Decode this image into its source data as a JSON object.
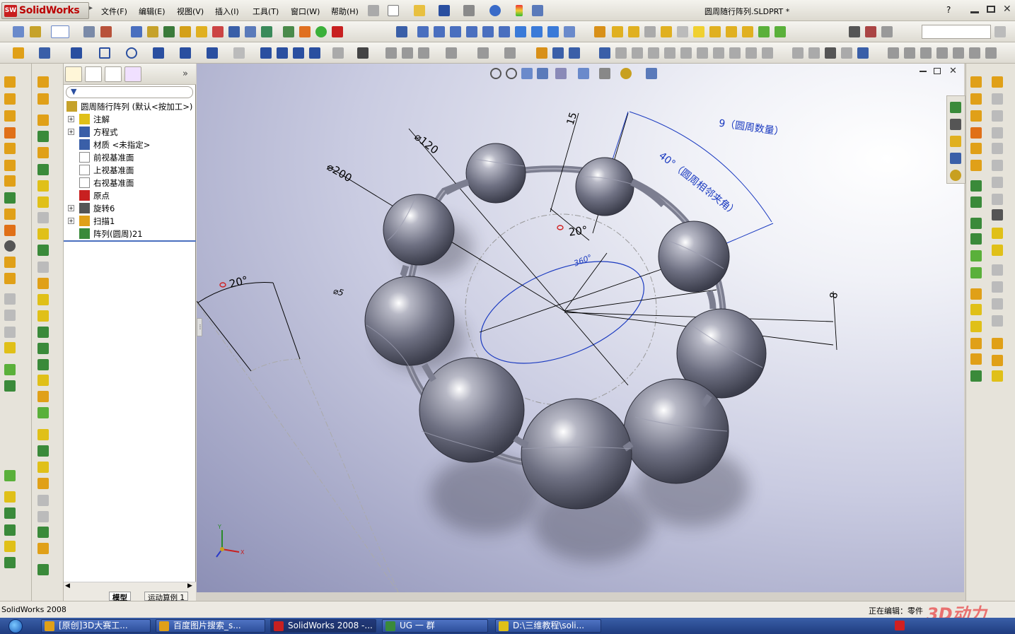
{
  "app": {
    "logo_text": "SolidWorks",
    "window_title": "圆周随行阵列.SLDPRT *",
    "menu": [
      "文件(F)",
      "编辑(E)",
      "视图(V)",
      "插入(I)",
      "工具(T)",
      "窗口(W)",
      "帮助(H)"
    ],
    "help_label": "?"
  },
  "tree": {
    "root_label": "圆周随行阵列 (默认<按加工>)",
    "items": [
      {
        "label": "注解",
        "expandable": true
      },
      {
        "label": "方程式",
        "expandable": true
      },
      {
        "label": "材质 <未指定>",
        "expandable": false
      },
      {
        "label": "前视基准面",
        "expandable": false
      },
      {
        "label": "上视基准面",
        "expandable": false
      },
      {
        "label": "右视基准面",
        "expandable": false
      },
      {
        "label": "原点",
        "expandable": false
      },
      {
        "label": "旋转6",
        "expandable": true
      },
      {
        "label": "扫描1",
        "expandable": true
      },
      {
        "label": "阵列(圆周)21",
        "expandable": false
      }
    ],
    "bottom_tabs": [
      "模型",
      "运动算例 1"
    ]
  },
  "dimensions": {
    "d15": "15",
    "d120": "⌀120",
    "d200": "⌀200",
    "count": "9（圆周数量）",
    "angle_desc": "40°（圆周相邻夹角）",
    "inner_angle": "20°",
    "sweep_angle": "360°",
    "d8": "8",
    "d5": "⌀5",
    "left_angle": "20°"
  },
  "status": {
    "left": "SolidWorks 2008",
    "right": "正在编辑：零件"
  },
  "taskbar": {
    "items": [
      {
        "label": "[原创]3D大赛工...",
        "active": false
      },
      {
        "label": "百度图片搜索_s...",
        "active": false
      },
      {
        "label": "SolidWorks 2008 -...",
        "active": true
      },
      {
        "label": "UG 一 群",
        "active": false
      },
      {
        "label": "D:\\三维教程\\soli...",
        "active": false
      }
    ]
  },
  "watermark": "3D动力"
}
